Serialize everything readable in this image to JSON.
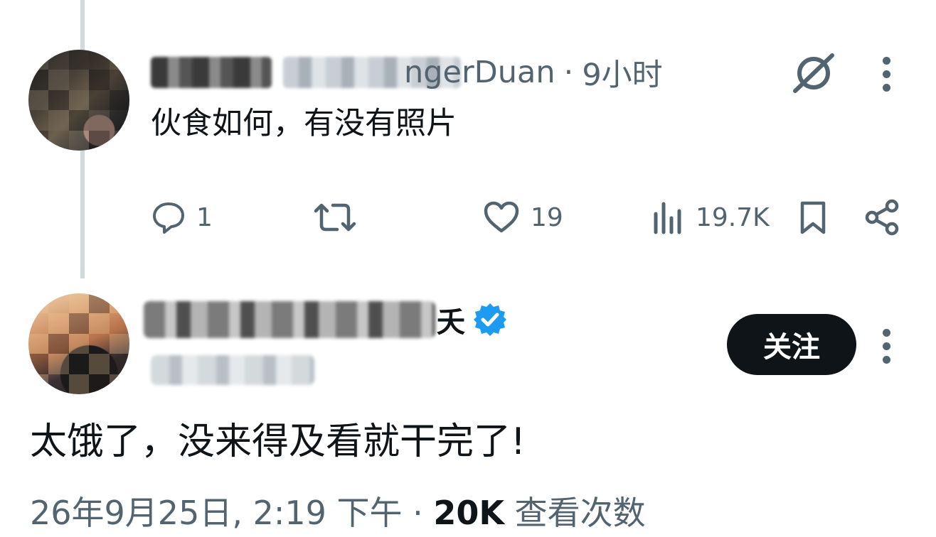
{
  "reply_tweet": {
    "handle_visible": "ngerDuan",
    "separator": "·",
    "time": "9小时",
    "text": "伙食如何，有没有照片",
    "actions": {
      "reply_count": "1",
      "retweet_count": "",
      "like_count": "19",
      "views_count": "19.7K"
    },
    "icons": [
      "grok-icon",
      "more-icon",
      "reply-icon",
      "retweet-icon",
      "like-icon",
      "views-icon",
      "bookmark-icon",
      "share-icon"
    ]
  },
  "main_tweet": {
    "name_visible": "夭",
    "verified": true,
    "follow_label": "关注",
    "text": "太饿了，没来得及看就干完了!",
    "timestamp": "26年9月25日, 2:19 下午",
    "dot": "·",
    "views": "20K",
    "views_label": "查看次数",
    "colors": {
      "verified": "#1d9bf0",
      "follow_bg": "#0f1419",
      "secondary_text": "#536471"
    }
  }
}
